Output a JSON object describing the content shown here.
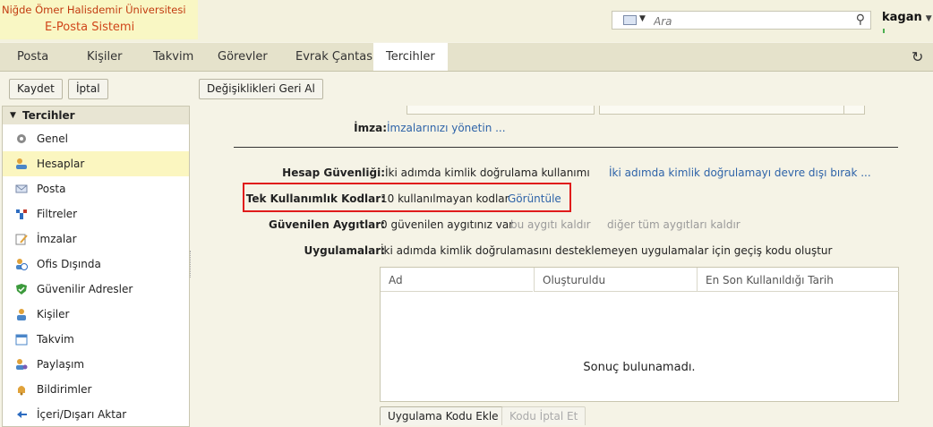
{
  "header": {
    "org_name": "Niğde Ömer Halisdemir Üniversitesi",
    "app_name": "E-Posta Sistemi",
    "search_placeholder": "Ara",
    "username": "kagan"
  },
  "tabs": [
    {
      "label": "Posta"
    },
    {
      "label": "Kişiler"
    },
    {
      "label": "Takvim"
    },
    {
      "label": "Görevler"
    },
    {
      "label": "Evrak Çantası"
    },
    {
      "label": "Tercihler"
    }
  ],
  "toolbar": {
    "save_label": "Kaydet",
    "cancel_label": "İptal",
    "revert_label": "Değişiklikleri Geri Al"
  },
  "sidebar": {
    "title": "Tercihler",
    "items": [
      {
        "label": "Genel",
        "icon": "gear-icon"
      },
      {
        "label": "Hesaplar",
        "icon": "accounts-icon"
      },
      {
        "label": "Posta",
        "icon": "mail-icon"
      },
      {
        "label": "Filtreler",
        "icon": "filter-icon"
      },
      {
        "label": "İmzalar",
        "icon": "signature-icon"
      },
      {
        "label": "Ofis Dışında",
        "icon": "out-of-office-icon"
      },
      {
        "label": "Güvenilir Adresler",
        "icon": "shield-icon"
      },
      {
        "label": "Kişiler",
        "icon": "person-icon"
      },
      {
        "label": "Takvim",
        "icon": "calendar-icon"
      },
      {
        "label": "Paylaşım",
        "icon": "sharing-icon"
      },
      {
        "label": "Bildirimler",
        "icon": "bell-icon"
      },
      {
        "label": "İçeri/Dışarı Aktar",
        "icon": "import-export-icon"
      }
    ],
    "selected": "Hesaplar"
  },
  "main": {
    "signature_label": "İmza:",
    "signature_link": "İmzalarınızı yönetin ...",
    "account_security_label": "Hesap Güvenliği:",
    "account_security_value": "İki adımda kimlik doğrulama kullanımı",
    "account_security_link": "İki adımda kimlik doğrulamayı devre dışı bırak ...",
    "one_time_codes_label": "Tek Kullanımlık Kodlar:",
    "one_time_codes_value": "10 kullanılmayan kodlar",
    "one_time_codes_link": "Görüntüle",
    "trusted_devices_label": "Güvenilen Aygıtlar:",
    "trusted_devices_value": "0 güvenilen aygıtınız var",
    "remove_this_device": "bu aygıtı kaldır",
    "remove_all_devices": "diğer tüm aygıtları kaldır",
    "apps_label": "Uygulamalar:",
    "apps_value": "İki adımda kimlik doğrulamasını desteklemeyen uygulamalar için geçiş kodu oluştur",
    "table_columns": [
      "Ad",
      "Oluşturuldu",
      "En Son Kullanıldığı Tarih"
    ],
    "empty_message": "Sonuç bulunamadı.",
    "add_app_code_label": "Uygulama Kodu Ekle",
    "revoke_code_label": "Kodu İptal Et"
  },
  "colors": {
    "accent_link": "#2e63a8",
    "highlight_box": "#e01b1b",
    "selected_bg": "#fbf6c0"
  }
}
